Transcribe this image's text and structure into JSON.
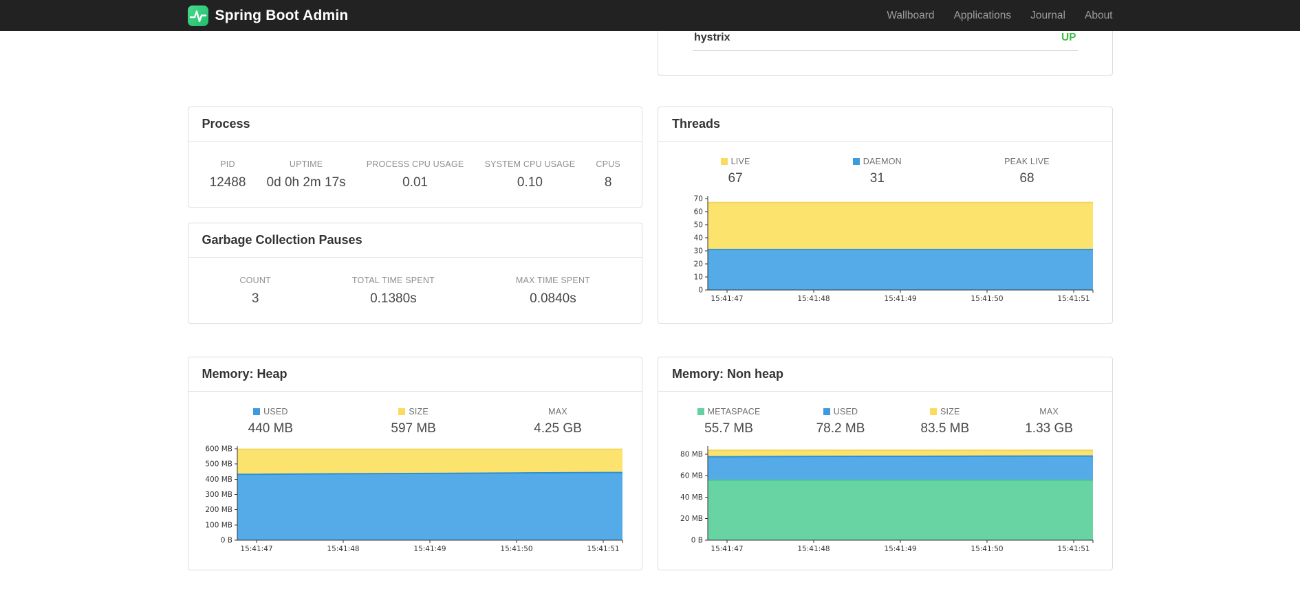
{
  "navbar": {
    "brand": "Spring Boot Admin",
    "links": [
      {
        "label": "Wallboard"
      },
      {
        "label": "Applications"
      },
      {
        "label": "Journal"
      },
      {
        "label": "About"
      }
    ]
  },
  "status_card": {
    "app_name": "hystrix",
    "status": "UP",
    "status_color": "#3ebe46"
  },
  "cards": {
    "process": {
      "title": "Process",
      "stats": [
        {
          "label": "PID",
          "value": "12488"
        },
        {
          "label": "UPTIME",
          "value": "0d 0h 2m 17s"
        },
        {
          "label": "PROCESS CPU USAGE",
          "value": "0.01"
        },
        {
          "label": "SYSTEM CPU USAGE",
          "value": "0.10"
        },
        {
          "label": "CPUS",
          "value": "8"
        }
      ]
    },
    "gc": {
      "title": "Garbage Collection Pauses",
      "stats": [
        {
          "label": "COUNT",
          "value": "3"
        },
        {
          "label": "TOTAL TIME SPENT",
          "value": "0.1380s"
        },
        {
          "label": "MAX TIME SPENT",
          "value": "0.0840s"
        }
      ]
    },
    "threads": {
      "title": "Threads",
      "legend": [
        {
          "label": "LIVE",
          "value": "67",
          "color": "#fbdb5e"
        },
        {
          "label": "DAEMON",
          "value": "31",
          "color": "#3d9ae1"
        },
        {
          "label": "PEAK LIVE",
          "value": "68"
        }
      ]
    },
    "heap": {
      "title": "Memory: Heap",
      "legend": [
        {
          "label": "USED",
          "value": "440 MB",
          "color": "#3d9ae1"
        },
        {
          "label": "SIZE",
          "value": "597 MB",
          "color": "#fbdb5e"
        },
        {
          "label": "MAX",
          "value": "4.25 GB"
        }
      ]
    },
    "nonheap": {
      "title": "Memory: Non heap",
      "legend": [
        {
          "label": "METASPACE",
          "value": "55.7 MB",
          "color": "#62d0a0"
        },
        {
          "label": "USED",
          "value": "78.2 MB",
          "color": "#3d9ae1"
        },
        {
          "label": "SIZE",
          "value": "83.5 MB",
          "color": "#fbdb5e"
        },
        {
          "label": "MAX",
          "value": "1.33 GB"
        }
      ]
    }
  },
  "chart_data": [
    {
      "id": "threads",
      "type": "area",
      "title": "Threads",
      "x": [
        "15:41:47",
        "15:41:48",
        "15:41:49",
        "15:41:50",
        "15:41:51"
      ],
      "y_max": 70,
      "grid": false,
      "y_ticks": [
        {
          "v": 0,
          "label": "0"
        },
        {
          "v": 10,
          "label": "10"
        },
        {
          "v": 20,
          "label": "20"
        },
        {
          "v": 30,
          "label": "30"
        },
        {
          "v": 40,
          "label": "40"
        },
        {
          "v": 50,
          "label": "50"
        },
        {
          "v": 60,
          "label": "60"
        },
        {
          "v": 70,
          "label": "70"
        }
      ],
      "series": [
        {
          "name": "LIVE",
          "fill": "#fbe36e",
          "stroke": "#f3d45c",
          "values": [
            67,
            67,
            67,
            67,
            67
          ]
        },
        {
          "name": "DAEMON",
          "fill": "#55abe8",
          "stroke": "#2c8fd8",
          "values": [
            31,
            31,
            31,
            31,
            31
          ]
        }
      ]
    },
    {
      "id": "heap",
      "type": "area",
      "title": "Memory: Heap",
      "x": [
        "15:41:47",
        "15:41:48",
        "15:41:49",
        "15:41:50",
        "15:41:51"
      ],
      "y_max": 600,
      "grid": false,
      "y_ticks": [
        {
          "v": 0,
          "label": "0 B"
        },
        {
          "v": 100,
          "label": "100 MB"
        },
        {
          "v": 200,
          "label": "200 MB"
        },
        {
          "v": 300,
          "label": "300 MB"
        },
        {
          "v": 400,
          "label": "400 MB"
        },
        {
          "v": 500,
          "label": "500 MB"
        },
        {
          "v": 600,
          "label": "600 MB"
        }
      ],
      "series": [
        {
          "name": "SIZE",
          "fill": "#fbe36e",
          "stroke": "#f3d45c",
          "values": [
            597,
            597,
            597,
            597,
            597
          ]
        },
        {
          "name": "USED",
          "fill": "#55abe8",
          "stroke": "#2c8fd8",
          "values": [
            432,
            436,
            438,
            441,
            444
          ]
        }
      ]
    },
    {
      "id": "nonheap",
      "type": "area",
      "title": "Memory: Non heap",
      "x": [
        "15:41:47",
        "15:41:48",
        "15:41:49",
        "15:41:50",
        "15:41:51"
      ],
      "y_max": 85,
      "grid": false,
      "y_ticks": [
        {
          "v": 0,
          "label": "0 B"
        },
        {
          "v": 20,
          "label": "20 MB"
        },
        {
          "v": 40,
          "label": "40 MB"
        },
        {
          "v": 60,
          "label": "60 MB"
        },
        {
          "v": 80,
          "label": "80 MB"
        }
      ],
      "series": [
        {
          "name": "SIZE",
          "fill": "#fbe36e",
          "stroke": "#f3d45c",
          "values": [
            83.5,
            83.5,
            83.5,
            83.5,
            83.5
          ]
        },
        {
          "name": "USED",
          "fill": "#55abe8",
          "stroke": "#2c8fd8",
          "values": [
            77.6,
            77.9,
            78.0,
            78.1,
            78.2
          ]
        },
        {
          "name": "METASPACE",
          "fill": "#68d4a4",
          "stroke": "#49c593",
          "values": [
            55.7,
            55.7,
            55.7,
            55.7,
            55.7
          ]
        }
      ]
    }
  ]
}
